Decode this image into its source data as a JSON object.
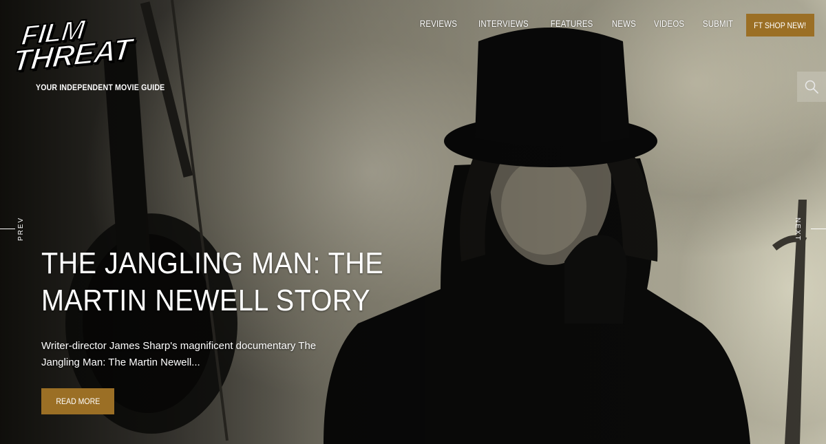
{
  "brand": {
    "logo_line1": "FILM",
    "logo_line2": "THREAT",
    "tagline": "YOUR INDEPENDENT MOVIE GUIDE"
  },
  "nav": {
    "items": [
      {
        "label": "REVIEWS"
      },
      {
        "label": "INTERVIEWS"
      },
      {
        "label": "FEATURES"
      },
      {
        "label": "NEWS"
      },
      {
        "label": "VIDEOS"
      },
      {
        "label": "SUBMIT"
      }
    ],
    "shop_label": "FT SHOP NEW!"
  },
  "slider": {
    "prev_label": "PREV",
    "next_label": "NEXT"
  },
  "featured": {
    "title": "THE JANGLING MAN: THE MARTIN NEWELL STORY",
    "excerpt": "Writer-director James Sharp's magnificent documentary The Jangling Man: The Martin Newell...",
    "button_label": "READ MORE"
  },
  "colors": {
    "accent": "#9b6f25",
    "text": "#ffffff"
  },
  "icons": {
    "search": "search-icon"
  }
}
